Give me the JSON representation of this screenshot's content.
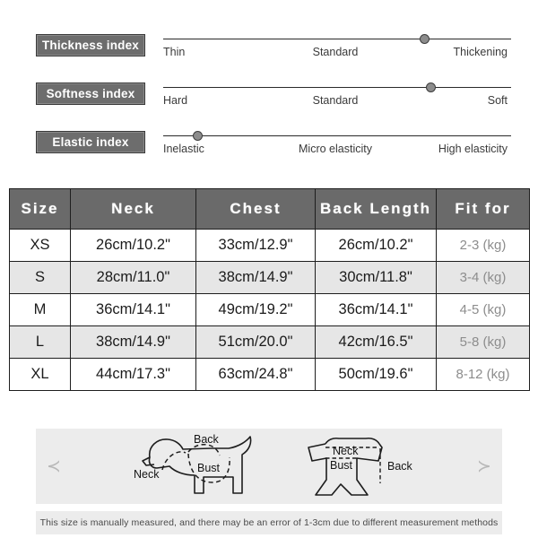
{
  "indices": [
    {
      "label": "Thickness index",
      "badge_name": "thickness-index-badge",
      "ticks": [
        "Thin",
        "Standard",
        "Thickening"
      ],
      "marker_percent": 75
    },
    {
      "label": "Softness index",
      "badge_name": "softness-index-badge",
      "ticks": [
        "Hard",
        "Standard",
        "Soft"
      ],
      "marker_percent": 77
    },
    {
      "label": "Elastic index",
      "badge_name": "elastic-index-badge",
      "ticks": [
        "Inelastic",
        "Micro elasticity",
        "High elasticity"
      ],
      "marker_percent": 10
    }
  ],
  "size_table": {
    "headers": [
      "Size",
      "Neck",
      "Chest",
      "Back Length",
      "Fit for"
    ],
    "rows": [
      {
        "size": "XS",
        "neck": "26cm/10.2\"",
        "chest": "33cm/12.9\"",
        "back": "26cm/10.2\"",
        "fit": "2-3 (kg)"
      },
      {
        "size": "S",
        "neck": "28cm/11.0\"",
        "chest": "38cm/14.9\"",
        "back": "30cm/11.8\"",
        "fit": "3-4 (kg)"
      },
      {
        "size": "M",
        "neck": "36cm/14.1\"",
        "chest": "49cm/19.2\"",
        "back": "36cm/14.1\"",
        "fit": "4-5 (kg)"
      },
      {
        "size": "L",
        "neck": "38cm/14.9\"",
        "chest": "51cm/20.0\"",
        "back": "42cm/16.5\"",
        "fit": "5-8 (kg)"
      },
      {
        "size": "XL",
        "neck": "44cm/17.3\"",
        "chest": "63cm/24.8\"",
        "back": "50cm/19.6\"",
        "fit": "8-12 (kg)"
      }
    ]
  },
  "illustration": {
    "prev_arrow": "≺",
    "next_arrow": "≻",
    "dog_labels": {
      "neck": "Neck",
      "back": "Back",
      "bust": "Bust"
    },
    "garment_labels": {
      "neck": "Neck",
      "bust": "Bust",
      "back": "Back"
    }
  },
  "footer": {
    "note": "This size is manually measured, and there may be an error of 1-3cm due to different measurement methods"
  },
  "colors": {
    "badge_bg": "#6d6d6d",
    "header_bg": "#6a6a6a",
    "row_alt_bg": "#e6e6e6",
    "panel_bg": "#ececec",
    "fit_text": "#8d8d8d"
  }
}
